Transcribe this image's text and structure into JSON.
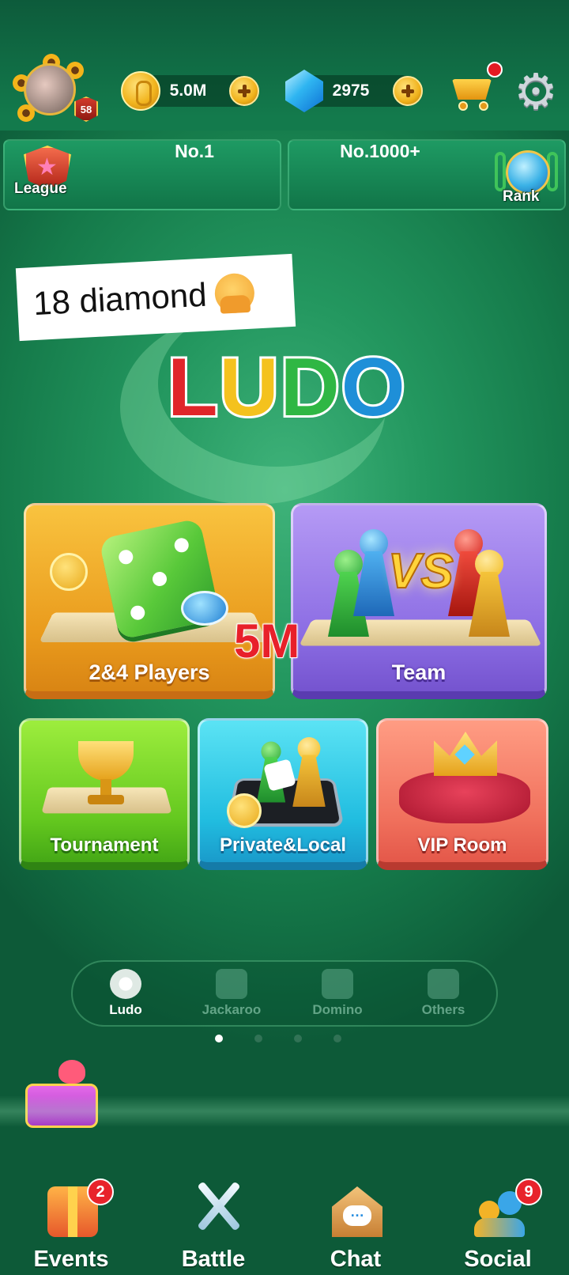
{
  "header": {
    "player_level": "58",
    "coins": "5.0M",
    "diamonds": "2975"
  },
  "rank_bar": {
    "league_label": "League",
    "league_rank": "No.1",
    "global_rank": "No.1000+",
    "rank_label": "Rank"
  },
  "overlay": {
    "sticker_text": "18 diamond",
    "sticker_emoji": "shrug-emoji",
    "amount_sticker": "5M"
  },
  "logo": {
    "letters": [
      "L",
      "U",
      "D",
      "O"
    ]
  },
  "modes": {
    "players": "2&4 Players",
    "team": "Team",
    "team_vs": "VS",
    "tournament": "Tournament",
    "private_local": "Private&Local",
    "vip_room": "VIP Room"
  },
  "game_switcher": {
    "items": [
      {
        "label": "Ludo",
        "active": true
      },
      {
        "label": "Jackaroo",
        "active": false
      },
      {
        "label": "Domino",
        "active": false
      },
      {
        "label": "Others",
        "active": false
      }
    ],
    "pages": 4,
    "current_page": 1
  },
  "bottom_nav": {
    "events": {
      "label": "Events",
      "badge": "2"
    },
    "battle": {
      "label": "Battle"
    },
    "chat": {
      "label": "Chat"
    },
    "social": {
      "label": "Social",
      "badge": "9"
    }
  },
  "colors": {
    "background": "#23975f",
    "logo_l": "#e0262a",
    "logo_u": "#f4c21e",
    "logo_d": "#2fb744",
    "logo_o": "#1e8fd8",
    "badge": "#e8232b"
  }
}
